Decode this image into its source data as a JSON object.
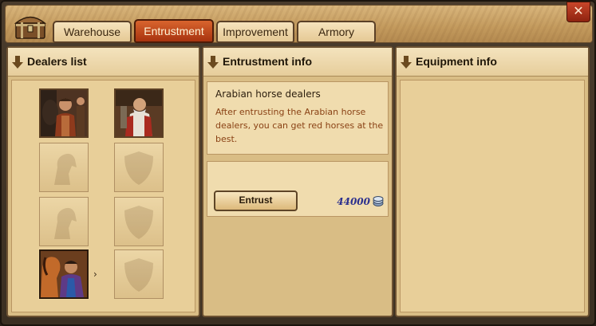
{
  "tabs": [
    {
      "label": "Warehouse",
      "active": false
    },
    {
      "label": "Entrustment",
      "active": true
    },
    {
      "label": "Improvement",
      "active": false
    },
    {
      "label": "Armory",
      "active": false
    }
  ],
  "close_icon": "close-icon",
  "panels": {
    "dealers": {
      "title": "Dealers list"
    },
    "entrustment": {
      "title": "Entrustment info"
    },
    "equipment": {
      "title": "Equipment info"
    }
  },
  "dealer": {
    "name": "Arabian horse dealers",
    "description": "After entrusting the Arabian horse dealers, you can get red horses at the best.",
    "entrust_label": "Entrust",
    "cost": "44000",
    "cost_icon": "silver-coin-icon"
  },
  "dealers_list": {
    "slots": [
      {
        "state": "filled",
        "portrait": "soldier-dealer-portrait"
      },
      {
        "state": "filled",
        "portrait": "armor-merchant-portrait"
      },
      {
        "state": "empty",
        "portrait": "horse-silhouette"
      },
      {
        "state": "empty",
        "portrait": "shield-silhouette"
      },
      {
        "state": "empty",
        "portrait": "horse-silhouette"
      },
      {
        "state": "empty",
        "portrait": "shield-silhouette"
      },
      {
        "state": "filled",
        "portrait": "arabian-horse-dealer-portrait",
        "selected": true
      },
      {
        "state": "empty",
        "portrait": "shield-silhouette"
      }
    ],
    "more_icon": "chevron-right-icon"
  },
  "colors": {
    "active_tab": "#b8401a",
    "panel_bg": "#d9bd85",
    "description_text": "#8a4215",
    "cost_text": "#2b2f8e"
  }
}
